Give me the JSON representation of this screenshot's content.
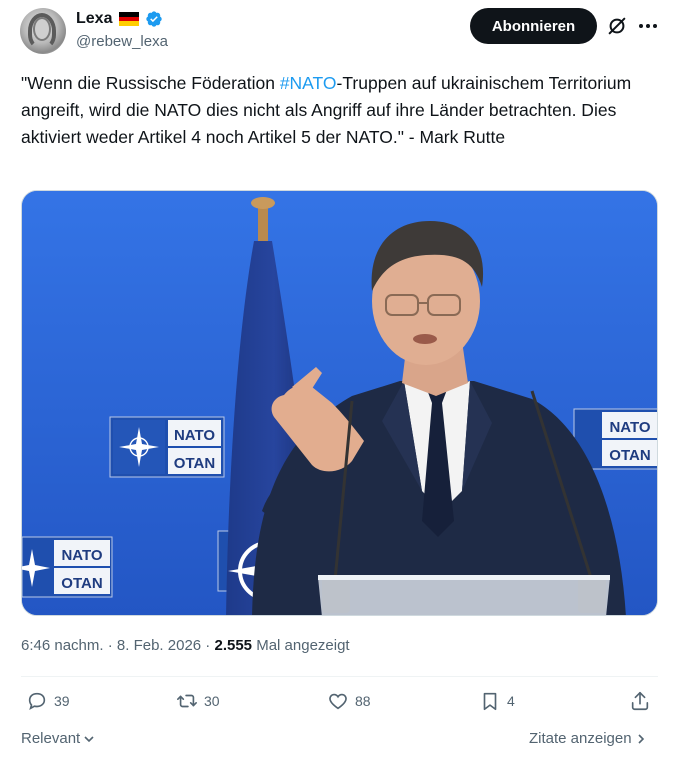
{
  "author": {
    "display_name": "Lexa",
    "handle": "@rebew_lexa",
    "flag": "germany-flag",
    "verified": true
  },
  "header": {
    "subscribe_label": "Abonnieren"
  },
  "tweet": {
    "text_before": "\"Wenn die Russische Föderation ",
    "hashtag": "#NATO",
    "text_after": "-Truppen auf ukrainischem Territorium angreift, wird die NATO dies nicht als Angriff auf ihre Länder betrachten. Dies aktiviert weder Artikel 4 noch Artikel 5 der NATO.\" - Mark Rutte"
  },
  "media": {
    "signs": [
      "NATO",
      "OTAN"
    ]
  },
  "meta": {
    "time": "6:46 nachm.",
    "separator": " · ",
    "date": "8. Feb. 2026",
    "views": "2.555",
    "views_label": " Mal angezeigt"
  },
  "actions": {
    "replies": "39",
    "retweets": "30",
    "likes": "88",
    "bookmarks": "4"
  },
  "footer": {
    "sort_label": "Relevant",
    "quotes_label": "Zitate anzeigen"
  },
  "colors": {
    "accent": "#1d9bf0",
    "text": "#0f1419",
    "secondary": "#536471",
    "button_bg": "#0f1419"
  }
}
